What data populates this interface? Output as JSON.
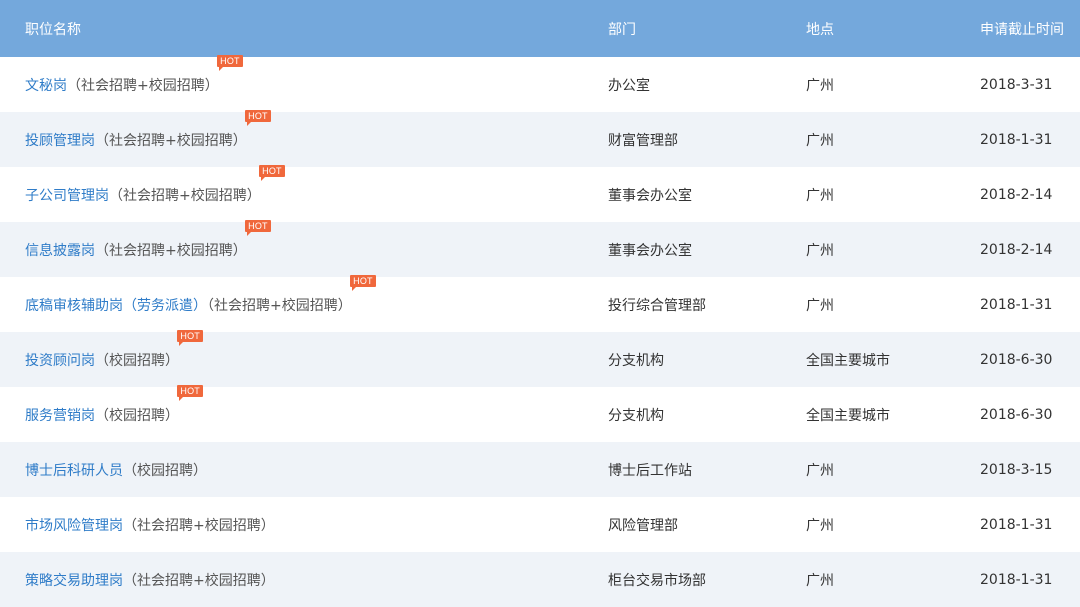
{
  "columns": [
    "职位名称",
    "部门",
    "地点",
    "申请截止时间"
  ],
  "hot_label": "HOT",
  "rows": [
    {
      "title": "文秘岗",
      "type": "（社会招聘+校园招聘）",
      "dept": "办公室",
      "location": "广州",
      "deadline": "2018-3-31",
      "hot": true
    },
    {
      "title": "投顾管理岗",
      "type": "（社会招聘+校园招聘）",
      "dept": "财富管理部",
      "location": "广州",
      "deadline": "2018-1-31",
      "hot": true
    },
    {
      "title": "子公司管理岗",
      "type": "（社会招聘+校园招聘）",
      "dept": "董事会办公室",
      "location": "广州",
      "deadline": "2018-2-14",
      "hot": true
    },
    {
      "title": "信息披露岗",
      "type": "（社会招聘+校园招聘）",
      "dept": "董事会办公室",
      "location": "广州",
      "deadline": "2018-2-14",
      "hot": true
    },
    {
      "title": "底稿审核辅助岗（劳务派遣）",
      "type": "（社会招聘+校园招聘）",
      "dept": "投行综合管理部",
      "location": "广州",
      "deadline": "2018-1-31",
      "hot": true
    },
    {
      "title": "投资顾问岗",
      "type": "（校园招聘）",
      "dept": "分支机构",
      "location": "全国主要城市",
      "deadline": "2018-6-30",
      "hot": true
    },
    {
      "title": "服务营销岗",
      "type": "（校园招聘）",
      "dept": "分支机构",
      "location": "全国主要城市",
      "deadline": "2018-6-30",
      "hot": true
    },
    {
      "title": "博士后科研人员",
      "type": "（校园招聘）",
      "dept": "博士后工作站",
      "location": "广州",
      "deadline": "2018-3-15",
      "hot": false
    },
    {
      "title": "市场风险管理岗",
      "type": "（社会招聘+校园招聘）",
      "dept": "风险管理部",
      "location": "广州",
      "deadline": "2018-1-31",
      "hot": false
    },
    {
      "title": "策略交易助理岗",
      "type": "（社会招聘+校园招聘）",
      "dept": "柜台交易市场部",
      "location": "广州",
      "deadline": "2018-1-31",
      "hot": false
    }
  ],
  "colors": {
    "header_bg": "#74a8dc",
    "link": "#2f7cc8",
    "hot": "#f0683c",
    "stripe": "#eff3f8"
  }
}
